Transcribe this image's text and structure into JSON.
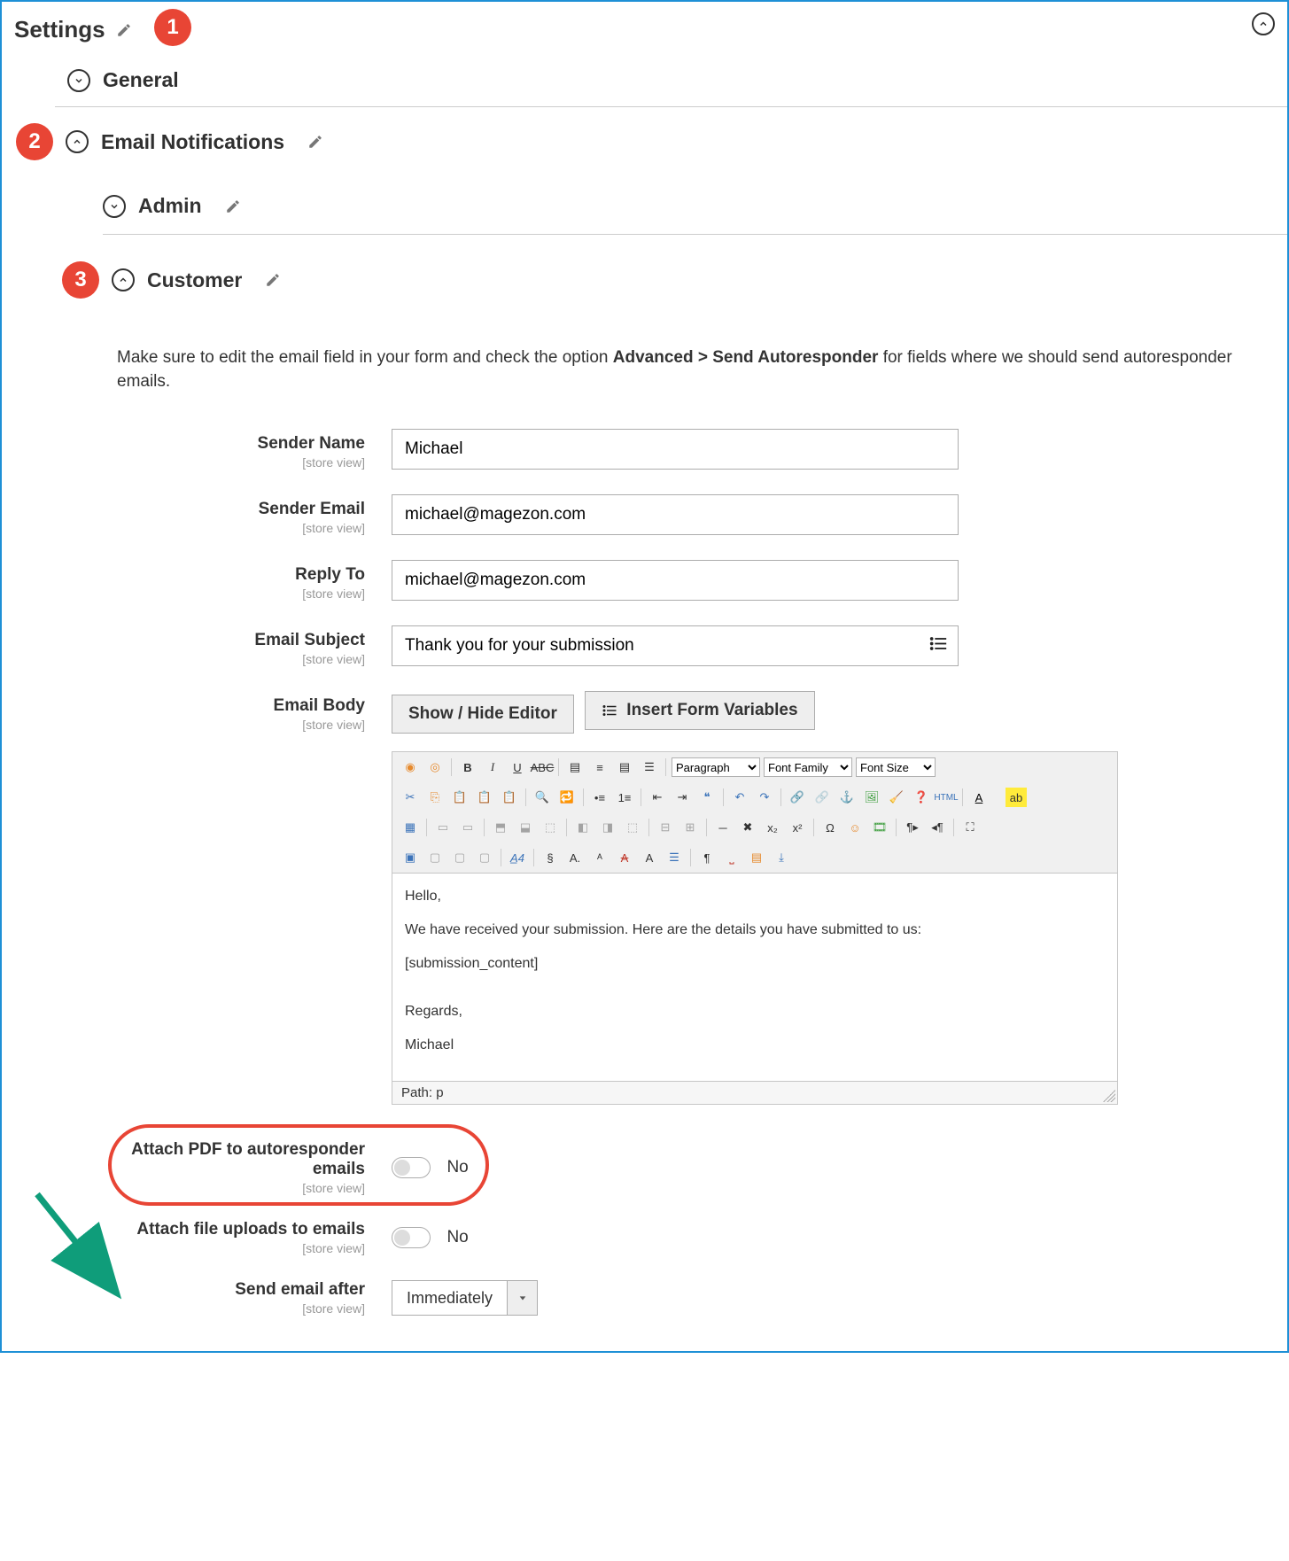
{
  "header": {
    "title": "Settings"
  },
  "badges": {
    "b1": "1",
    "b2": "2",
    "b3": "3"
  },
  "sections": {
    "general": {
      "label": "General"
    },
    "emailNotifications": {
      "label": "Email Notifications"
    },
    "admin": {
      "label": "Admin"
    },
    "customer": {
      "label": "Customer"
    }
  },
  "note": {
    "pre": "Make sure to edit the email field in your form and check the option ",
    "bold": "Advanced > Send Autoresponder",
    "post": " for fields where we should send autoresponder emails."
  },
  "scope": "[store view]",
  "fields": {
    "senderName": {
      "label": "Sender Name",
      "value": "Michael"
    },
    "senderEmail": {
      "label": "Sender Email",
      "value": "michael@magezon.com"
    },
    "replyTo": {
      "label": "Reply To",
      "value": "michael@magezon.com"
    },
    "emailSubject": {
      "label": "Email Subject",
      "value": "Thank you for your submission"
    },
    "emailBody": {
      "label": "Email Body"
    },
    "attachPdf": {
      "label": "Attach PDF to autoresponder emails",
      "value": "No"
    },
    "attachFiles": {
      "label": "Attach file uploads to emails",
      "value": "No"
    },
    "sendAfter": {
      "label": "Send email after",
      "value": "Immediately"
    }
  },
  "buttons": {
    "showHideEditor": "Show / Hide Editor",
    "insertFormVariables": "Insert Form Variables"
  },
  "editor": {
    "dropdowns": {
      "paragraph": "Paragraph",
      "fontFamily": "Font Family",
      "fontSize": "Font Size"
    },
    "content": {
      "l1": "Hello,",
      "l2": "We have received your submission. Here are the details you have submitted to us:",
      "l3": "[submission_content]",
      "l4": "Regards,",
      "l5": "Michael"
    },
    "path": "Path: p"
  }
}
